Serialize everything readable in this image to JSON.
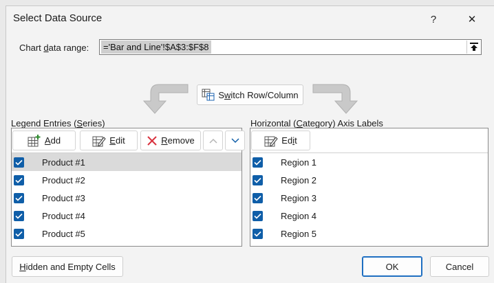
{
  "dialog": {
    "title": "Select Data Source",
    "help_label": "?",
    "close_label": "✕"
  },
  "range": {
    "label_pre": "Chart ",
    "label_access": "d",
    "label_post": "ata range:",
    "value": "='Bar and Line'!$A$3:$F$8"
  },
  "switch": {
    "pre": "S",
    "access": "w",
    "post": "itch Row/Column"
  },
  "legend": {
    "label_pre": "Legend Entries (",
    "label_access": "S",
    "label_post": "eries)",
    "add": {
      "access": "A",
      "rest": "dd"
    },
    "edit": {
      "access": "E",
      "rest": "dit"
    },
    "remove": {
      "access": "R",
      "rest": "emove"
    },
    "items": [
      {
        "label": "Product #1",
        "checked": true,
        "selected": true
      },
      {
        "label": "Product #2",
        "checked": true,
        "selected": false
      },
      {
        "label": "Product #3",
        "checked": true,
        "selected": false
      },
      {
        "label": "Product #4",
        "checked": true,
        "selected": false
      },
      {
        "label": "Product #5",
        "checked": true,
        "selected": false
      }
    ]
  },
  "axis": {
    "label_pre": "Horizontal (",
    "label_access": "C",
    "label_post": "ategory) Axis Labels",
    "edit": {
      "pre": "Ed",
      "access": "i",
      "post": "t"
    },
    "items": [
      {
        "label": "Region 1",
        "checked": true
      },
      {
        "label": "Region 2",
        "checked": true
      },
      {
        "label": "Region 3",
        "checked": true
      },
      {
        "label": "Region 4",
        "checked": true
      },
      {
        "label": "Region 5",
        "checked": true
      }
    ]
  },
  "footer": {
    "hidden": {
      "access": "H",
      "rest": "idden and Empty Cells"
    },
    "ok": "OK",
    "cancel": "Cancel"
  },
  "colors": {
    "accent": "#0f5ea8",
    "selection": "#dadada",
    "remove_red": "#d9333f"
  }
}
